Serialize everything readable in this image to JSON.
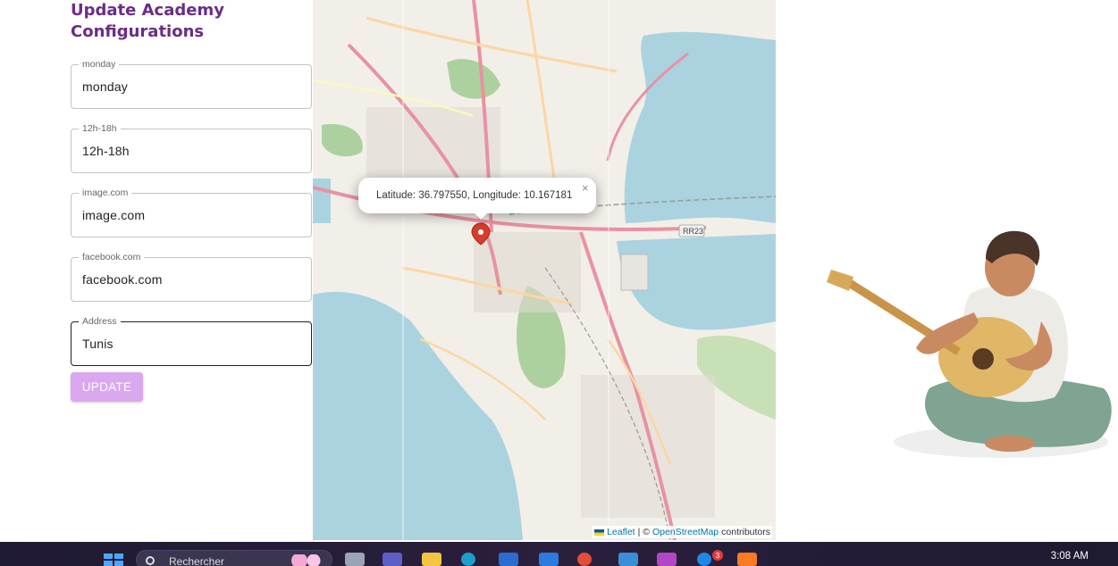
{
  "form": {
    "title": "Update Academy Configurations",
    "fields": [
      {
        "label": "monday",
        "value": "monday"
      },
      {
        "label": "12h-18h",
        "value": "12h-18h"
      },
      {
        "label": "image.com",
        "value": "image.com"
      },
      {
        "label": "facebook.com",
        "value": "facebook.com"
      },
      {
        "label": "Address",
        "value": "Tunis"
      }
    ],
    "update_label": "UPDATE"
  },
  "map": {
    "popup_text": "Latitude: 36.797550, Longitude: 10.167181",
    "popup_close": "×",
    "road_badge": "RR23",
    "attribution": {
      "leaflet": "Leaflet",
      "separator": "| ©",
      "osm": "OpenStreetMap",
      "suffix": "contributors"
    },
    "colors": {
      "water": "#aad3df",
      "land": "#f2efe9",
      "park": "#add19e",
      "major_road": "#e892a2",
      "road": "#fcd6a4",
      "marker": "#d63e2a"
    }
  },
  "taskbar": {
    "search_placeholder": "Rechercher",
    "notification_count": "3",
    "clock": "3:08 AM",
    "apps": [
      "file-explorer-icon",
      "teams-icon",
      "folder-icon",
      "edge-icon",
      "store-icon",
      "mail-icon",
      "chrome-icon",
      "app-icon",
      "phpstorm-icon",
      "skype-icon",
      "xampp-icon"
    ]
  }
}
